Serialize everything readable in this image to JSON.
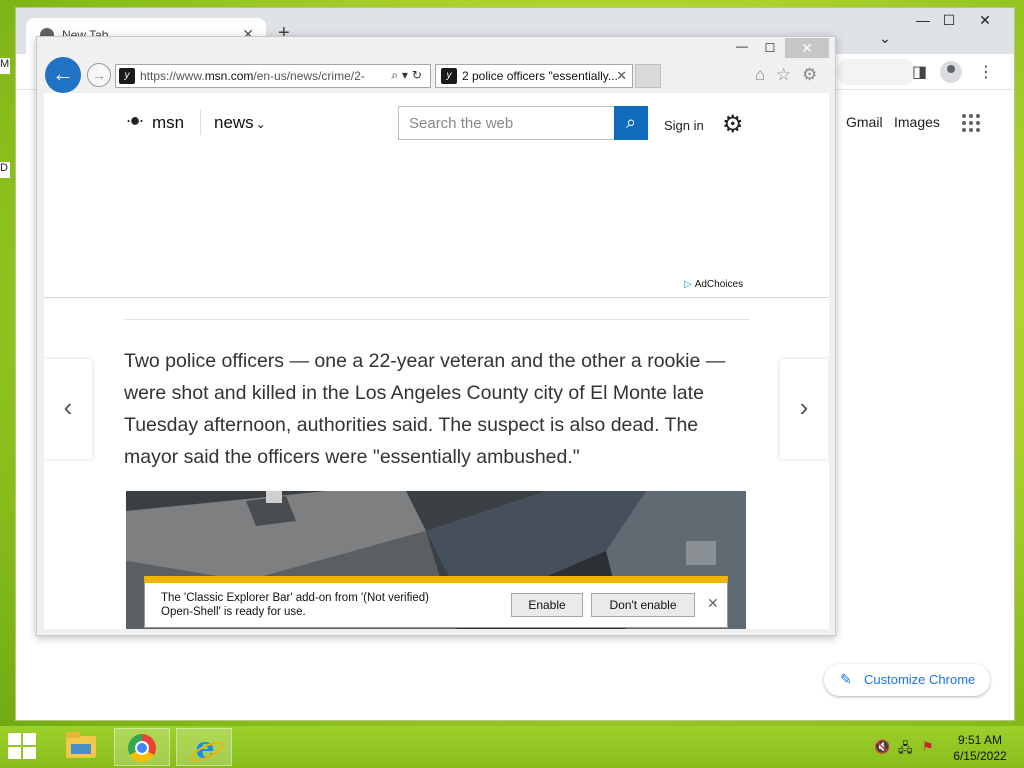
{
  "desktop": {
    "fragments": [
      "M",
      "D"
    ]
  },
  "chrome": {
    "tab_title": "New Tab",
    "tab_close": "✕",
    "new_tab": "+",
    "caption": {
      "minimize": "—",
      "maximize": "☐",
      "close": "✕",
      "dropdown": "⌄"
    },
    "links": {
      "gmail": "Gmail",
      "images": "Images"
    },
    "customize_label": "Customize Chrome",
    "customize_icon": "✎"
  },
  "ie": {
    "caption": {
      "minimize": "—",
      "maximize": "☐",
      "close": "✕"
    },
    "back_icon": "←",
    "forward_icon": "→",
    "address": {
      "prefix": "https://www.",
      "domain": "msn.com",
      "path": "/en-us/news/crime/2-",
      "tools": "⌕▾↻"
    },
    "tab": {
      "title": "2 police officers \"essentially...",
      "close": "✕"
    },
    "toolbar_icons": {
      "home": "⌂",
      "favorites": "☆",
      "settings": "⚙"
    }
  },
  "msn": {
    "logo_text": "msn",
    "logo_icon": "butterfly-icon",
    "section": "news",
    "section_chevron": "⌄",
    "search_placeholder": "Search the web",
    "search_icon": "⌕",
    "sign_in": "Sign in",
    "settings_icon": "⚙",
    "adchoices": "AdChoices",
    "article_text": "Two police officers — one a 22-year veteran and the other a rookie — were shot and killed in the Los Angeles County city of El Monte late Tuesday afternoon, authorities said. The suspect is also dead. The mayor said the officers were \"essentially ambushed.\"",
    "prev_arrow": "‹",
    "next_arrow": "›"
  },
  "notification": {
    "message": "The 'Classic Explorer Bar' add-on from '(Not verified) Open-Shell' is ready for use.",
    "enable_label": "Enable",
    "dont_enable_label": "Don't enable",
    "close": "✕"
  },
  "taskbar": {
    "clock_time": "9:51 AM",
    "clock_date": "6/15/2022",
    "tray": {
      "volume": "🔇",
      "network": "🖧",
      "flag": "⚑"
    }
  }
}
